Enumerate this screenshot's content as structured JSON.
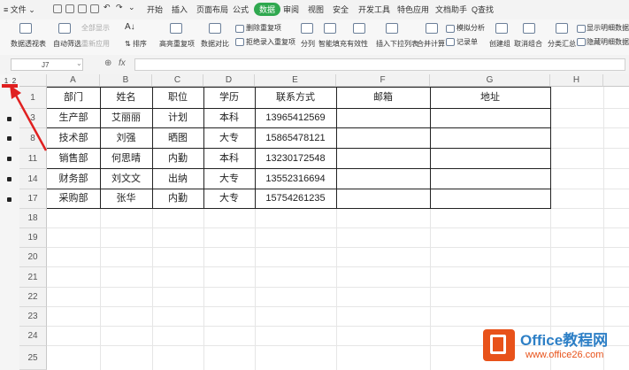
{
  "menu": {
    "file_label": "文件",
    "tabs": [
      "开始",
      "插入",
      "页面布局",
      "公式",
      "数据",
      "审阅",
      "视图",
      "安全",
      "开发工具",
      "特色应用",
      "文档助手"
    ],
    "active_tab": "数据",
    "search_label": "Q查找"
  },
  "ribbon": {
    "pivot": "数据透视表",
    "autofilter": "自动筛选",
    "show_all": "全部显示",
    "reapply": "重新应用",
    "sort_label": "排序",
    "highlight_dup": "高亮重复项",
    "data_compare": "数据对比",
    "remove_dup": "删除重复项",
    "reject_dup": "拒绝录入重复项",
    "split": "分列",
    "smart_fill": "智能填充",
    "validity": "有效性",
    "dropdown": "插入下拉列表",
    "consolidate": "合并计算",
    "simulate": "模拟分析",
    "record_form": "记录单",
    "group": "创建组",
    "ungroup": "取消组合",
    "subtotal": "分类汇总",
    "show_detail": "显示明细数据",
    "hide_detail": "隐藏明细数据"
  },
  "formula_bar": {
    "cell_ref": "J7",
    "fx_label": "fx",
    "content": ""
  },
  "outline": {
    "levels": [
      "1",
      "2"
    ]
  },
  "sheet": {
    "columns": [
      "A",
      "B",
      "C",
      "D",
      "E",
      "F",
      "G",
      "H"
    ],
    "rows": [
      "1",
      "3",
      "8",
      "11",
      "14",
      "17",
      "18",
      "19",
      "20",
      "21",
      "22",
      "23",
      "24",
      "25"
    ],
    "header": [
      "部门",
      "姓名",
      "职位",
      "学历",
      "联系方式",
      "邮箱",
      "地址"
    ],
    "data": [
      [
        "生产部",
        "艾丽丽",
        "计划",
        "本科",
        "13965412569",
        "",
        ""
      ],
      [
        "技术部",
        "刘强",
        "晒图",
        "大专",
        "15865478121",
        "",
        ""
      ],
      [
        "销售部",
        "何思晴",
        "内勤",
        "本科",
        "13230172548",
        "",
        ""
      ],
      [
        "财务部",
        "刘文文",
        "出纳",
        "大专",
        "13552316694",
        "",
        ""
      ],
      [
        "采购部",
        "张华",
        "内勤",
        "大专",
        "15754261235",
        "",
        ""
      ]
    ]
  },
  "watermark": {
    "brand": "Office教程网",
    "url": "www.office26.com",
    "brand_color": "#2d7fc6",
    "accent_color": "#e8521a"
  },
  "colors": {
    "accent_green": "#2fa84f",
    "annotation_red": "#e02020"
  }
}
